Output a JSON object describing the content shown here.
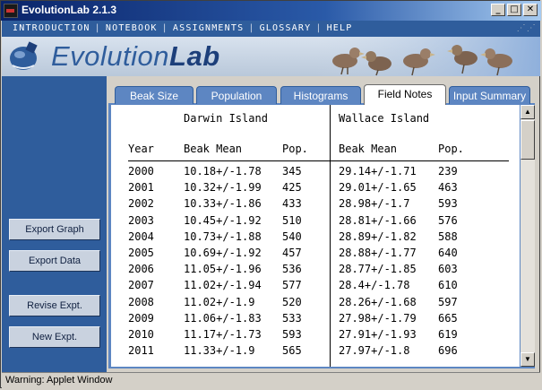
{
  "window": {
    "title": "EvolutionLab 2.1.3",
    "controls": {
      "minimize": "_",
      "maximize": "□",
      "close": "✕"
    }
  },
  "menu": {
    "items": [
      "INTRODUCTION",
      "NOTEBOOK",
      "ASSIGNMENTS",
      "GLOSSARY",
      "HELP"
    ],
    "separator": "|"
  },
  "banner": {
    "logo_regular": "Evolution",
    "logo_bold": "Lab",
    "logo_icon": "flask-globe-icon",
    "decoration": "finch-birds-illustration"
  },
  "sidebar": {
    "buttons": [
      {
        "label": "Export Graph"
      },
      {
        "label": "Export Data"
      },
      {
        "label": "Revise Expt."
      },
      {
        "label": "New Expt."
      }
    ]
  },
  "tabs": [
    {
      "label": "Beak Size",
      "active": false
    },
    {
      "label": "Population",
      "active": false
    },
    {
      "label": "Histograms",
      "active": false
    },
    {
      "label": "Field Notes",
      "active": true
    },
    {
      "label": "Input Summary",
      "active": false
    }
  ],
  "field_notes": {
    "island_left": "Darwin Island",
    "island_right": "Wallace Island",
    "headers": {
      "year": "Year",
      "beak_mean_left": "Beak Mean",
      "pop_left": "Pop.",
      "beak_mean_right": "Beak Mean",
      "pop_right": "Pop."
    },
    "rows": [
      {
        "year": "2000",
        "d_beak": "10.18+/-1.78",
        "d_pop": "345",
        "w_beak": "29.14+/-1.71",
        "w_pop": "239"
      },
      {
        "year": "2001",
        "d_beak": "10.32+/-1.99",
        "d_pop": "425",
        "w_beak": "29.01+/-1.65",
        "w_pop": "463"
      },
      {
        "year": "2002",
        "d_beak": "10.33+/-1.86",
        "d_pop": "433",
        "w_beak": "28.98+/-1.7",
        "w_pop": "593"
      },
      {
        "year": "2003",
        "d_beak": "10.45+/-1.92",
        "d_pop": "510",
        "w_beak": "28.81+/-1.66",
        "w_pop": "576"
      },
      {
        "year": "2004",
        "d_beak": "10.73+/-1.88",
        "d_pop": "540",
        "w_beak": "28.89+/-1.82",
        "w_pop": "588"
      },
      {
        "year": "2005",
        "d_beak": "10.69+/-1.92",
        "d_pop": "457",
        "w_beak": "28.88+/-1.77",
        "w_pop": "640"
      },
      {
        "year": "2006",
        "d_beak": "11.05+/-1.96",
        "d_pop": "536",
        "w_beak": "28.77+/-1.85",
        "w_pop": "603"
      },
      {
        "year": "2007",
        "d_beak": "11.02+/-1.94",
        "d_pop": "577",
        "w_beak": "28.4+/-1.78",
        "w_pop": "610"
      },
      {
        "year": "2008",
        "d_beak": "11.02+/-1.9",
        "d_pop": "520",
        "w_beak": "28.26+/-1.68",
        "w_pop": "597"
      },
      {
        "year": "2009",
        "d_beak": "11.06+/-1.83",
        "d_pop": "533",
        "w_beak": "27.98+/-1.79",
        "w_pop": "665"
      },
      {
        "year": "2010",
        "d_beak": "11.17+/-1.73",
        "d_pop": "593",
        "w_beak": "27.91+/-1.93",
        "w_pop": "619"
      },
      {
        "year": "2011",
        "d_beak": "11.33+/-1.9",
        "d_pop": "565",
        "w_beak": "27.97+/-1.8",
        "w_pop": "696"
      }
    ]
  },
  "scrollbar": {
    "up_icon": "arrow-up-icon",
    "down_icon": "arrow-down-icon"
  },
  "status": {
    "text": "Warning: Applet Window"
  }
}
